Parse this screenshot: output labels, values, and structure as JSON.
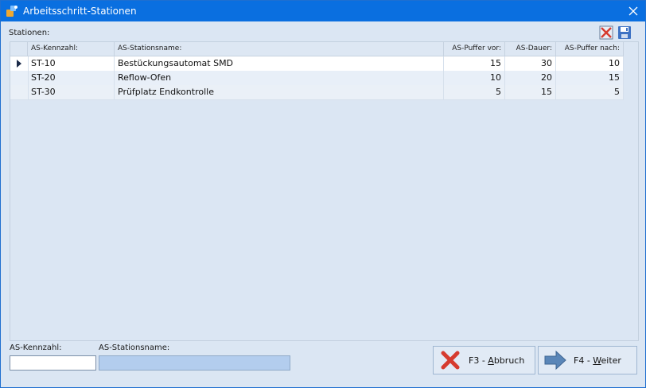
{
  "window": {
    "title": "Arbeitsschritt-Stationen"
  },
  "stations_label": "Stationen:",
  "toolbar": {
    "delete_icon": "delete-icon",
    "save_icon": "save-icon"
  },
  "grid": {
    "columns": [
      {
        "key": "kennzahl",
        "label": "AS-Kennzahl:"
      },
      {
        "key": "name",
        "label": "AS-Stationsname:"
      },
      {
        "key": "puffer_vor",
        "label": "AS-Puffer vor:"
      },
      {
        "key": "dauer",
        "label": "AS-Dauer:"
      },
      {
        "key": "puffer_nach",
        "label": "AS-Puffer nach:"
      }
    ],
    "rows": [
      {
        "kennzahl": "ST-10",
        "name": "Bestückungsautomat SMD",
        "puffer_vor": "15",
        "dauer": "30",
        "puffer_nach": "10",
        "selected": true
      },
      {
        "kennzahl": "ST-20",
        "name": "Reflow-Ofen",
        "puffer_vor": "10",
        "dauer": "20",
        "puffer_nach": "15",
        "selected": false
      },
      {
        "kennzahl": "ST-30",
        "name": "Prüfplatz Endkontrolle",
        "puffer_vor": "5",
        "dauer": "15",
        "puffer_nach": "5",
        "selected": false
      }
    ]
  },
  "form": {
    "kennzahl_label": "AS-Kennzahl:",
    "kennzahl_value": "",
    "stationsname_label": "AS-Stationsname:",
    "stationsname_value": ""
  },
  "buttons": {
    "cancel_prefix": "F3 - ",
    "cancel_hotkey": "A",
    "cancel_rest": "bbruch",
    "next_prefix": "F4 - ",
    "next_hotkey": "W",
    "next_rest": "eiter"
  },
  "colors": {
    "titlebar": "#0a6fe0",
    "background": "#dbe6f3",
    "cancel_icon": "#d63b2f",
    "next_icon": "#5a86b8",
    "readonly_field": "#b3cdee"
  }
}
